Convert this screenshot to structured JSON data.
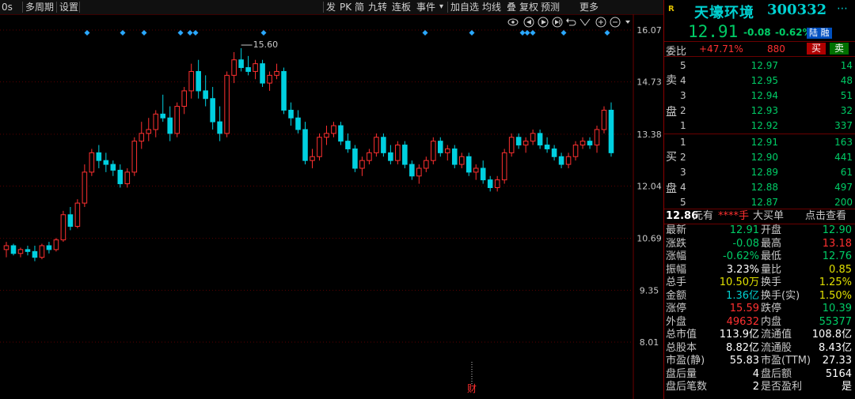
{
  "toolbar": {
    "left_items": [
      "0s",
      "多周期",
      "设置"
    ],
    "right_items": [
      "发",
      "PK",
      "简",
      "九转",
      "连板",
      "事件",
      "加自选",
      "均线",
      "叠",
      "复权",
      "预测",
      "更多"
    ],
    "event_arrow": "▾",
    "icons": [
      "eye-icon",
      "play-back-icon",
      "play-icon",
      "play-forward-icon",
      "undo-icon",
      "fit-icon",
      "zoom-in-icon",
      "zoom-out-icon",
      "dropdown-icon"
    ]
  },
  "chart_data": {
    "type": "candlestick",
    "y_ticks": [
      "16.07",
      "14.73",
      "13.38",
      "12.04",
      "10.69",
      "9.35",
      "8.01"
    ],
    "y_range": [
      8.01,
      16.07
    ],
    "high_marker": "15.60",
    "bottom_marker": "财",
    "colors": {
      "up": "#ff3030",
      "down": "#00d0e0",
      "marker": "#2aa8ff",
      "grid": "#5a0000"
    },
    "candles": [
      [
        10.4,
        10.6,
        10.2,
        10.5
      ],
      [
        10.5,
        10.55,
        10.25,
        10.3
      ],
      [
        10.3,
        10.45,
        10.2,
        10.4
      ],
      [
        10.4,
        10.5,
        10.25,
        10.35
      ],
      [
        10.35,
        10.5,
        10.1,
        10.2
      ],
      [
        10.2,
        10.55,
        10.15,
        10.5
      ],
      [
        10.5,
        10.6,
        10.3,
        10.4
      ],
      [
        10.4,
        10.7,
        10.35,
        10.65
      ],
      [
        10.65,
        11.4,
        10.6,
        11.3
      ],
      [
        11.3,
        11.5,
        10.9,
        11.0
      ],
      [
        11.0,
        11.7,
        10.95,
        11.6
      ],
      [
        11.6,
        12.6,
        11.5,
        12.4
      ],
      [
        12.4,
        13.0,
        12.3,
        12.9
      ],
      [
        12.9,
        13.1,
        12.5,
        12.7
      ],
      [
        12.7,
        12.9,
        12.4,
        12.6
      ],
      [
        12.6,
        12.7,
        12.3,
        12.45
      ],
      [
        12.45,
        12.6,
        12.0,
        12.1
      ],
      [
        12.1,
        12.5,
        12.0,
        12.4
      ],
      [
        12.4,
        13.3,
        12.3,
        13.2
      ],
      [
        13.2,
        13.7,
        13.0,
        13.4
      ],
      [
        13.4,
        13.8,
        13.2,
        13.5
      ],
      [
        13.5,
        14.0,
        13.3,
        13.9
      ],
      [
        13.9,
        14.4,
        13.7,
        13.8
      ],
      [
        13.8,
        14.1,
        13.2,
        13.4
      ],
      [
        13.4,
        14.2,
        13.3,
        14.1
      ],
      [
        14.1,
        14.6,
        13.9,
        14.5
      ],
      [
        14.5,
        15.2,
        14.3,
        15.0
      ],
      [
        15.0,
        15.3,
        14.3,
        14.5
      ],
      [
        14.5,
        14.9,
        14.1,
        14.3
      ],
      [
        14.3,
        14.6,
        13.5,
        13.7
      ],
      [
        13.7,
        14.1,
        13.2,
        13.4
      ],
      [
        13.4,
        15.0,
        13.3,
        14.9
      ],
      [
        14.9,
        15.5,
        14.7,
        15.3
      ],
      [
        15.3,
        15.6,
        15.0,
        15.1
      ],
      [
        15.1,
        15.4,
        14.9,
        15.0
      ],
      [
        15.0,
        15.3,
        14.8,
        15.2
      ],
      [
        15.2,
        15.3,
        14.6,
        14.7
      ],
      [
        14.7,
        15.0,
        14.5,
        14.9
      ],
      [
        14.9,
        15.2,
        14.8,
        15.0
      ],
      [
        15.0,
        15.1,
        13.9,
        14.0
      ],
      [
        14.0,
        14.2,
        13.6,
        13.8
      ],
      [
        13.8,
        14.0,
        13.4,
        13.5
      ],
      [
        13.5,
        13.7,
        12.6,
        12.7
      ],
      [
        12.7,
        13.0,
        12.5,
        12.8
      ],
      [
        12.8,
        13.4,
        12.7,
        13.3
      ],
      [
        13.3,
        13.6,
        13.1,
        13.4
      ],
      [
        13.4,
        13.7,
        13.3,
        13.6
      ],
      [
        13.6,
        13.7,
        13.1,
        13.2
      ],
      [
        13.2,
        13.4,
        12.9,
        13.0
      ],
      [
        13.0,
        13.1,
        12.4,
        12.5
      ],
      [
        12.5,
        12.8,
        12.3,
        12.7
      ],
      [
        12.7,
        13.0,
        12.6,
        12.9
      ],
      [
        12.9,
        13.4,
        12.8,
        13.3
      ],
      [
        13.3,
        13.4,
        12.8,
        12.9
      ],
      [
        12.9,
        13.1,
        12.6,
        12.7
      ],
      [
        12.7,
        13.2,
        12.6,
        13.1
      ],
      [
        13.1,
        13.2,
        12.5,
        12.6
      ],
      [
        12.6,
        12.7,
        12.2,
        12.3
      ],
      [
        12.3,
        12.6,
        12.1,
        12.5
      ],
      [
        12.5,
        12.8,
        12.4,
        12.7
      ],
      [
        12.7,
        13.3,
        12.6,
        13.2
      ],
      [
        13.2,
        13.3,
        12.8,
        12.9
      ],
      [
        12.9,
        13.1,
        12.7,
        13.0
      ],
      [
        13.0,
        13.1,
        12.5,
        12.6
      ],
      [
        12.6,
        12.9,
        12.5,
        12.8
      ],
      [
        12.8,
        12.9,
        12.3,
        12.4
      ],
      [
        12.4,
        12.6,
        12.2,
        12.5
      ],
      [
        12.5,
        12.7,
        12.1,
        12.2
      ],
      [
        12.2,
        12.3,
        11.9,
        12.0
      ],
      [
        12.0,
        12.3,
        11.9,
        12.2
      ],
      [
        12.2,
        13.0,
        12.1,
        12.9
      ],
      [
        12.9,
        13.4,
        12.8,
        13.3
      ],
      [
        13.3,
        13.4,
        13.0,
        13.1
      ],
      [
        13.1,
        13.3,
        12.9,
        13.2
      ],
      [
        13.2,
        13.5,
        13.1,
        13.4
      ],
      [
        13.4,
        13.5,
        13.0,
        13.1
      ],
      [
        13.1,
        13.3,
        12.9,
        13.0
      ],
      [
        13.0,
        13.1,
        12.7,
        12.8
      ],
      [
        12.8,
        12.9,
        12.5,
        12.6
      ],
      [
        12.6,
        12.9,
        12.5,
        12.8
      ],
      [
        12.8,
        13.2,
        12.7,
        13.1
      ],
      [
        13.1,
        13.3,
        13.0,
        13.2
      ],
      [
        13.2,
        13.3,
        13.0,
        13.1
      ],
      [
        13.1,
        13.6,
        12.9,
        13.5
      ],
      [
        13.5,
        14.1,
        13.4,
        14.0
      ],
      [
        14.0,
        14.2,
        12.8,
        12.9
      ]
    ]
  },
  "quote": {
    "r_badge": "R",
    "name": "天壕环境",
    "code": "300332",
    "price": "12.91",
    "change": "-0.08",
    "change_pct": "-0.62%",
    "tag": "陆 融",
    "weibi_label": "委比",
    "weibi_pct": "+47.71%",
    "weibi_num": "880",
    "buy_btn": "买",
    "sell_btn": "卖"
  },
  "sell_side": {
    "label": "卖盘",
    "rows": [
      {
        "level": "5",
        "price": "12.97",
        "vol": "14"
      },
      {
        "level": "4",
        "price": "12.95",
        "vol": "48"
      },
      {
        "level": "3",
        "price": "12.94",
        "vol": "51"
      },
      {
        "level": "2",
        "price": "12.93",
        "vol": "32"
      },
      {
        "level": "1",
        "price": "12.92",
        "vol": "337"
      }
    ]
  },
  "buy_side": {
    "label": "买盘",
    "rows": [
      {
        "level": "1",
        "price": "12.91",
        "vol": "163"
      },
      {
        "level": "2",
        "price": "12.90",
        "vol": "441"
      },
      {
        "level": "3",
        "price": "12.89",
        "vol": "61"
      },
      {
        "level": "4",
        "price": "12.88",
        "vol": "497"
      },
      {
        "level": "5",
        "price": "12.87",
        "vol": "200"
      }
    ]
  },
  "big_order": {
    "price": "12.86",
    "unit": "元有",
    "stars": "****手",
    "text": "大买单",
    "link": "点击查看"
  },
  "stats": [
    {
      "l1": "最新",
      "v1": "12.91",
      "c1": "green",
      "l2": "开盘",
      "v2": "12.90",
      "c2": "green"
    },
    {
      "l1": "涨跌",
      "v1": "-0.08",
      "c1": "green",
      "l2": "最高",
      "v2": "13.18",
      "c2": "red"
    },
    {
      "l1": "涨幅",
      "v1": "-0.62%",
      "c1": "green",
      "l2": "最低",
      "v2": "12.76",
      "c2": "green"
    },
    {
      "l1": "振幅",
      "v1": "3.23%",
      "c1": "white",
      "l2": "量比",
      "v2": "0.85",
      "c2": "yel"
    },
    {
      "l1": "总手",
      "v1": "10.50万",
      "c1": "yel",
      "l2": "换手",
      "v2": "1.25%",
      "c2": "yel"
    },
    {
      "l1": "金额",
      "v1": "1.36亿",
      "c1": "cyan",
      "l2": "换手(实)",
      "v2": "1.50%",
      "c2": "yel"
    },
    {
      "l1": "涨停",
      "v1": "15.59",
      "c1": "red",
      "l2": "跌停",
      "v2": "10.39",
      "c2": "green"
    },
    {
      "l1": "外盘",
      "v1": "49632",
      "c1": "red",
      "l2": "内盘",
      "v2": "55377",
      "c2": "green"
    },
    {
      "l1": "总市值",
      "v1": "113.9亿",
      "c1": "white",
      "l2": "流通值",
      "v2": "108.8亿",
      "c2": "white"
    },
    {
      "l1": "总股本",
      "v1": "8.82亿",
      "c1": "white",
      "l2": "流通股",
      "v2": "8.43亿",
      "c2": "white"
    },
    {
      "l1": "市盈(静)",
      "v1": "55.83",
      "c1": "white",
      "l2": "市盈(TTM)",
      "v2": "27.33",
      "c2": "white"
    },
    {
      "l1": "盘后量",
      "v1": "4",
      "c1": "white",
      "l2": "盘后额",
      "v2": "5164",
      "c2": "white"
    },
    {
      "l1": "盘后笔数",
      "v1": "2",
      "c1": "white",
      "l2": "是否盈利",
      "v2": "是",
      "c2": "white"
    }
  ]
}
